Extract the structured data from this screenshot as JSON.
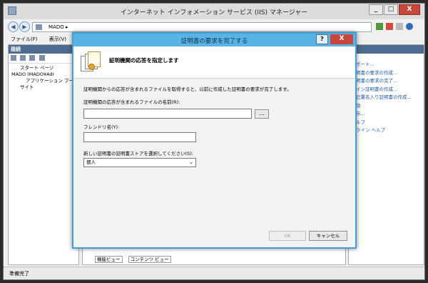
{
  "window": {
    "title": "インターネット インフォメーション サービス (IIS) マネージャー",
    "controls": [
      "_",
      "□",
      "X"
    ]
  },
  "address": {
    "path": "MADO",
    "separator": "▸",
    "back_icon": "back-arrow-icon",
    "forward_icon": "forward-arrow-icon"
  },
  "menu": [
    "ファイル(F)",
    "表示(V)",
    "ヘ"
  ],
  "left_pane": {
    "header": "接続",
    "tree": [
      "スタート ページ",
      "MADO (MADO¥Adr",
      "アプリケーション プー",
      "サイト"
    ]
  },
  "view_tabs": [
    "機能ビュー",
    "コンテンツ ビュー"
  ],
  "right_pane": {
    "actions": [
      "ポート...",
      "明書の要求の作成...",
      "明書の要求の完了...",
      "イン証明書の作成...",
      "己署名入り証明書の作成...",
      "除",
      "示...",
      "ルプ",
      "ライン ヘルプ"
    ]
  },
  "status": "準備完了",
  "dialog": {
    "title": "証明書の要求を完了する",
    "help": "?",
    "close": "X",
    "heading": "証明機関の応答を指定します",
    "description": "証明機関からの応答が含まれるファイルを取得すると、以前に作成した証明書の要求が完了します。",
    "file_label": "証明機関の応答が含まれるファイルの名前(R):",
    "file_value": "",
    "browse": "...",
    "friendly_label": "フレンドリ名(Y):",
    "friendly_value": "",
    "store_label": "新しい証明書の証明書ストアを選択してください(S):",
    "store_value": "個人",
    "ok": "OK",
    "cancel": "キャンセル"
  },
  "colors": {
    "dialog_title": "#58b3e6",
    "close_button": "#c9463d",
    "pane_header": "#4f6b8f",
    "link": "#1f57a6"
  }
}
